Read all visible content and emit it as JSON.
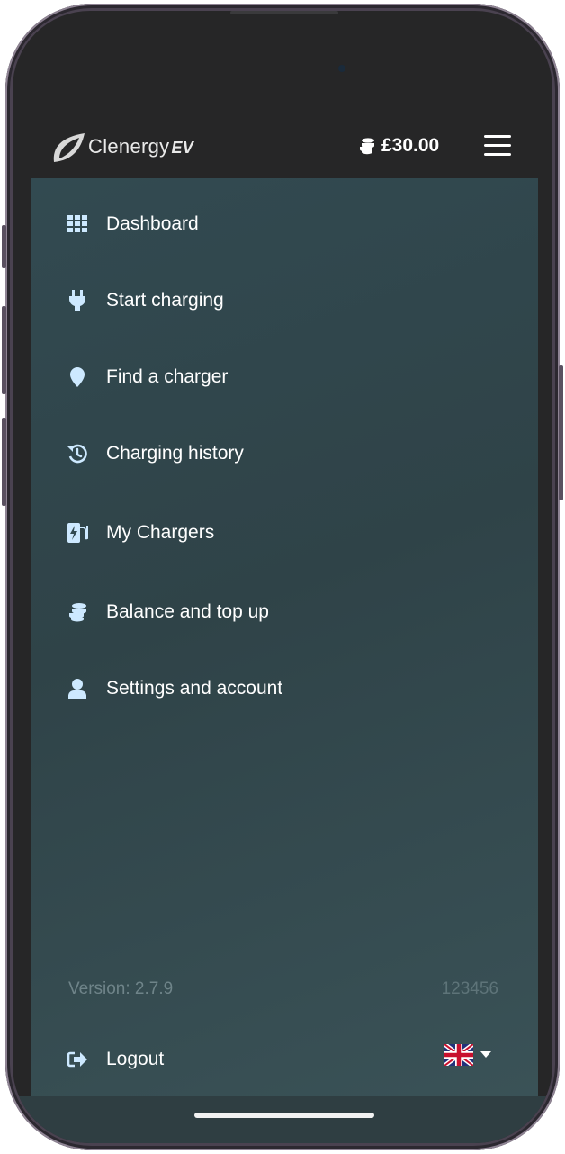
{
  "header": {
    "brand_main": "Clenergy",
    "brand_suffix": "EV",
    "balance": "£30.00"
  },
  "nav": {
    "items": [
      {
        "label": "Dashboard",
        "icon": "grid-icon"
      },
      {
        "label": "Start charging",
        "icon": "plug-icon"
      },
      {
        "label": "Find a charger",
        "icon": "map-pin-icon"
      },
      {
        "label": "Charging history",
        "icon": "history-icon"
      },
      {
        "label": "My Chargers",
        "icon": "charger-station-icon"
      },
      {
        "label": "Balance and top up",
        "icon": "coins-icon"
      },
      {
        "label": "Settings and account",
        "icon": "user-icon"
      }
    ]
  },
  "footer": {
    "version": "Version: 2.7.9",
    "account_id": "123456",
    "logout_label": "Logout",
    "language_icon": "uk-flag-icon"
  },
  "colors": {
    "accent_icon": "#cde9ff",
    "drawer_background": "#324a51"
  }
}
